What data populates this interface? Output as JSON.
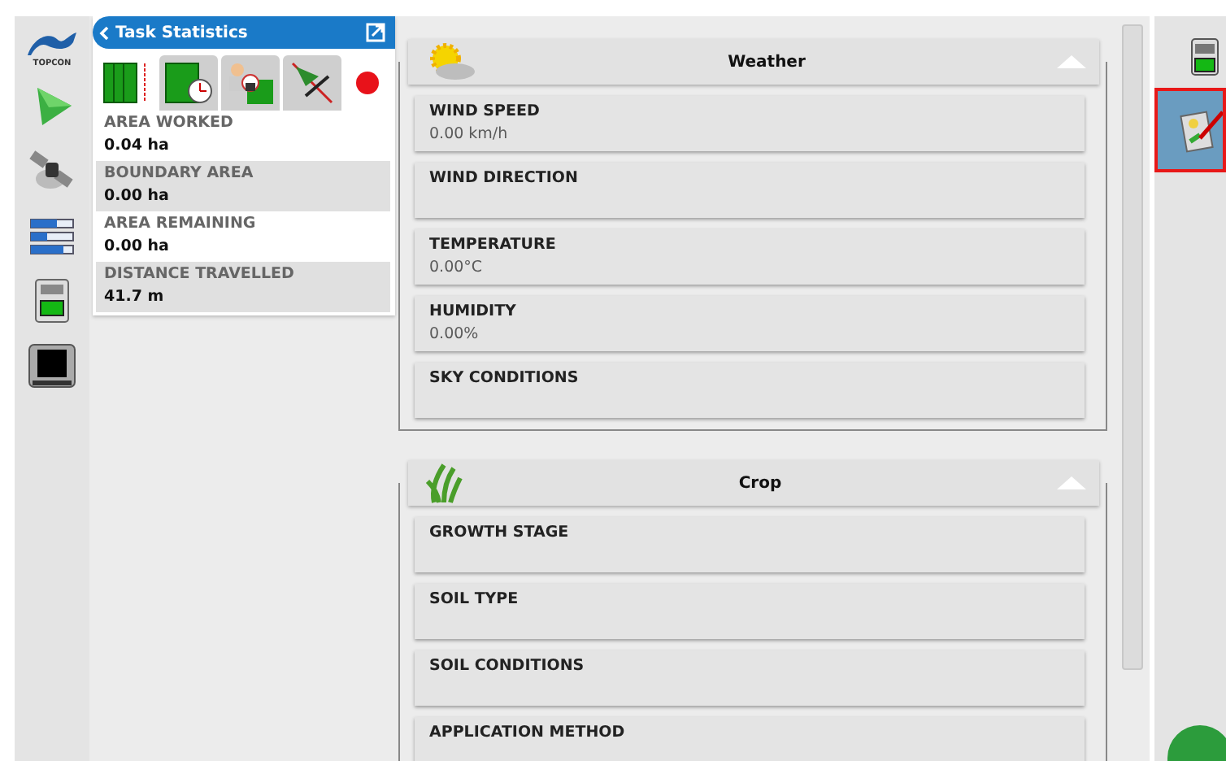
{
  "left_sidebar": {
    "logo_text": "TOPCON",
    "items": [
      {
        "kind": "navigation"
      },
      {
        "kind": "satellite"
      },
      {
        "kind": "bars"
      },
      {
        "kind": "device"
      },
      {
        "kind": "console"
      }
    ]
  },
  "task_statistics": {
    "title": "Task Statistics",
    "tabs": [
      {
        "kind": "area",
        "selected": true
      },
      {
        "kind": "time",
        "selected": false
      },
      {
        "kind": "operator",
        "selected": false
      },
      {
        "kind": "guidance",
        "selected": false
      }
    ],
    "record": {
      "on": true
    },
    "stats": [
      {
        "label": "AREA WORKED",
        "value": "0.04 ha"
      },
      {
        "label": "BOUNDARY AREA",
        "value": "0.00 ha"
      },
      {
        "label": "AREA REMAINING",
        "value": "0.00 ha"
      },
      {
        "label": "DISTANCE TRAVELLED",
        "value": "41.7 m"
      }
    ]
  },
  "sections": [
    {
      "kind": "weather",
      "title": "Weather",
      "expanded": true,
      "fields": [
        {
          "label": "WIND SPEED",
          "value": "0.00 km/h"
        },
        {
          "label": "WIND DIRECTION"
        },
        {
          "label": "TEMPERATURE",
          "value": "0.00°C"
        },
        {
          "label": "HUMIDITY",
          "value": "0.00%"
        },
        {
          "label": "SKY CONDITIONS"
        }
      ]
    },
    {
      "kind": "crop",
      "title": "Crop",
      "expanded": true,
      "fields": [
        {
          "label": "GROWTH STAGE"
        },
        {
          "label": "SOIL TYPE"
        },
        {
          "label": "SOIL CONDITIONS"
        },
        {
          "label": "APPLICATION METHOD"
        }
      ]
    }
  ],
  "right_sidebar": {
    "items": [
      {
        "kind": "device",
        "selected": false
      },
      {
        "kind": "notes",
        "selected": true
      }
    ]
  }
}
